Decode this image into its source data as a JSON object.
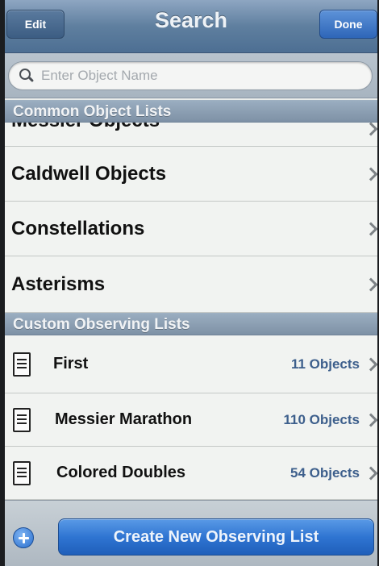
{
  "navbar": {
    "title": "Search",
    "edit_label": "Edit",
    "done_label": "Done"
  },
  "search": {
    "placeholder": "Enter Object Name",
    "value": ""
  },
  "sections": {
    "common_header": "Common Object Lists",
    "custom_header": "Custom Observing Lists"
  },
  "common_lists": [
    {
      "label": "Messier Objects"
    },
    {
      "label": "Caldwell Objects"
    },
    {
      "label": "Constellations"
    },
    {
      "label": "Asterisms"
    }
  ],
  "custom_lists": [
    {
      "label": "First",
      "count": "11 Objects"
    },
    {
      "label": "Messier Marathon",
      "count": "110 Objects"
    },
    {
      "label": "Colored Doubles",
      "count": "54 Objects"
    }
  ],
  "toolbar": {
    "create_label": "Create New Observing List"
  },
  "colors": {
    "navbar": "#5f7f9f",
    "accent_button": "#2f75d2",
    "count_text": "#3d5f8c"
  },
  "icons": [
    "search-icon",
    "chevron-right-icon",
    "document-icon",
    "add-icon"
  ]
}
